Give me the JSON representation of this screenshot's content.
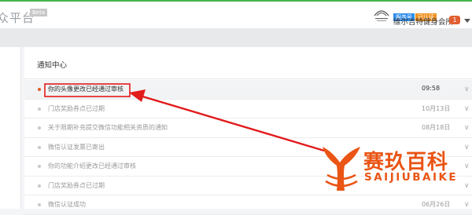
{
  "header": {
    "app_title": "众平台",
    "beta_label": "Beta",
    "badges": [
      "服务号",
      "已认证"
    ],
    "account_name": "维尔吉特健身会所",
    "notification_count": "1"
  },
  "main": {
    "title": "通知中心",
    "notifications": [
      {
        "text": "你的头像更改已经通过审核",
        "date": "09:58"
      },
      {
        "text": "门店奖励券点已过期",
        "date": "10月13日"
      },
      {
        "text": "关于限期补充提交微信功能相关资质的通知",
        "date": "08月18日"
      },
      {
        "text": "微信认证发票已寄出",
        "date": ""
      },
      {
        "text": "你的功能介绍更改已经通过审核",
        "date": ""
      },
      {
        "text": "门店奖励券点已过期",
        "date": ""
      },
      {
        "text": "微信认证成功",
        "date": "06月26日"
      }
    ]
  },
  "watermark": {
    "cn": "赛玖百科",
    "en": "SAIJIUBAIKE"
  },
  "colors": {
    "accent_green": "#44b549",
    "highlight_red": "#e21b1b",
    "brand_orange": "#ea5414",
    "badge_blue": "#2e8ded",
    "badge_orange": "#f09325"
  }
}
